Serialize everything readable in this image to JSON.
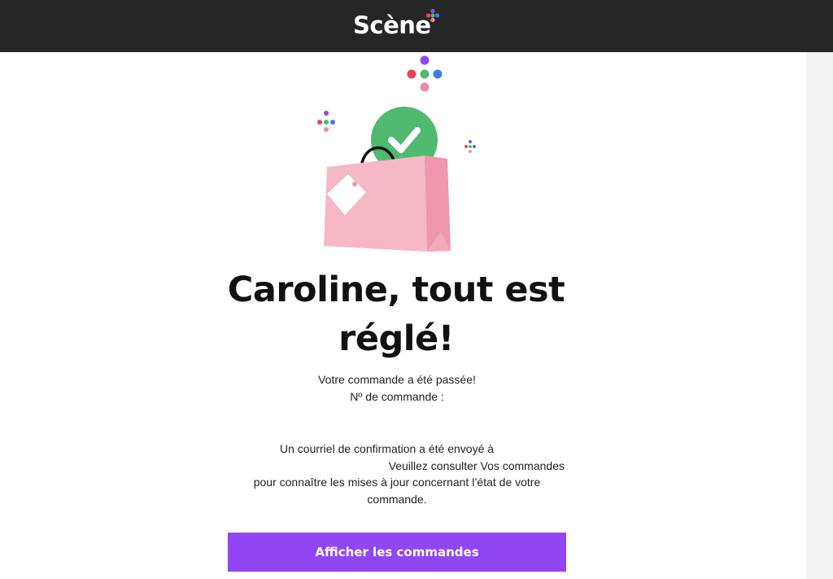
{
  "header": {
    "logo_text": "Scène",
    "logo_mark": "+"
  },
  "hero": {
    "illustration_icon": "shopping-bag-checkmark-icon"
  },
  "headline": {
    "line1": "Caroline, tout est",
    "line2": "réglé!"
  },
  "order": {
    "placed_text": "Votre commande a été passée!",
    "number_label": "Nº de commande :"
  },
  "confirmation": {
    "line1": "Un courriel de confirmation a été envoyé à",
    "line2": "Veuillez consulter Vos commandes",
    "line3": "pour connaître les mises à jour concernant l’état de votre",
    "line4": "commande."
  },
  "actions": {
    "view_orders_label": "Afficher les commandes"
  },
  "colors": {
    "topbar": "#262626",
    "accent_purple": "#9146f4",
    "check_green": "#4eb96f",
    "bag_pink": "#f6b8c6",
    "dot_red": "#e6434f",
    "dot_blue": "#3d7be8",
    "dot_pink": "#ee8aa6"
  }
}
